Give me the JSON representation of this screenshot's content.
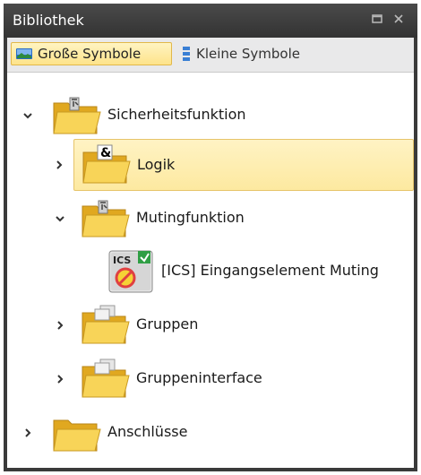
{
  "window": {
    "title": "Bibliothek",
    "maximize_icon": "maximize-icon",
    "close_icon": "close-icon"
  },
  "toolbar": {
    "large_icons_label": "Große Symbole",
    "small_icons_label": "Kleine Symbole"
  },
  "tree": {
    "items": [
      {
        "label": "Sicherheitsfunktion",
        "expanded": true,
        "icon": "folder-robot-icon"
      },
      {
        "label": "Logik",
        "expanded": false,
        "selected": true,
        "icon": "folder-ampersand-icon"
      },
      {
        "label": "Mutingfunktion",
        "expanded": true,
        "icon": "folder-robot-icon"
      },
      {
        "label": "[ICS] Eingangselement Muting",
        "icon": "ics-block-icon",
        "badge": "ICS"
      },
      {
        "label": "Gruppen",
        "expanded": false,
        "icon": "folder-group-icon"
      },
      {
        "label": "Gruppeninterface",
        "expanded": false,
        "icon": "folder-group-icon"
      },
      {
        "label": "Anschlüsse",
        "expanded": false,
        "icon": "folder-icon"
      }
    ]
  },
  "colors": {
    "titlebar": "#3a3a3a",
    "selection": "#fde9a0",
    "folder": "#f5c842"
  }
}
